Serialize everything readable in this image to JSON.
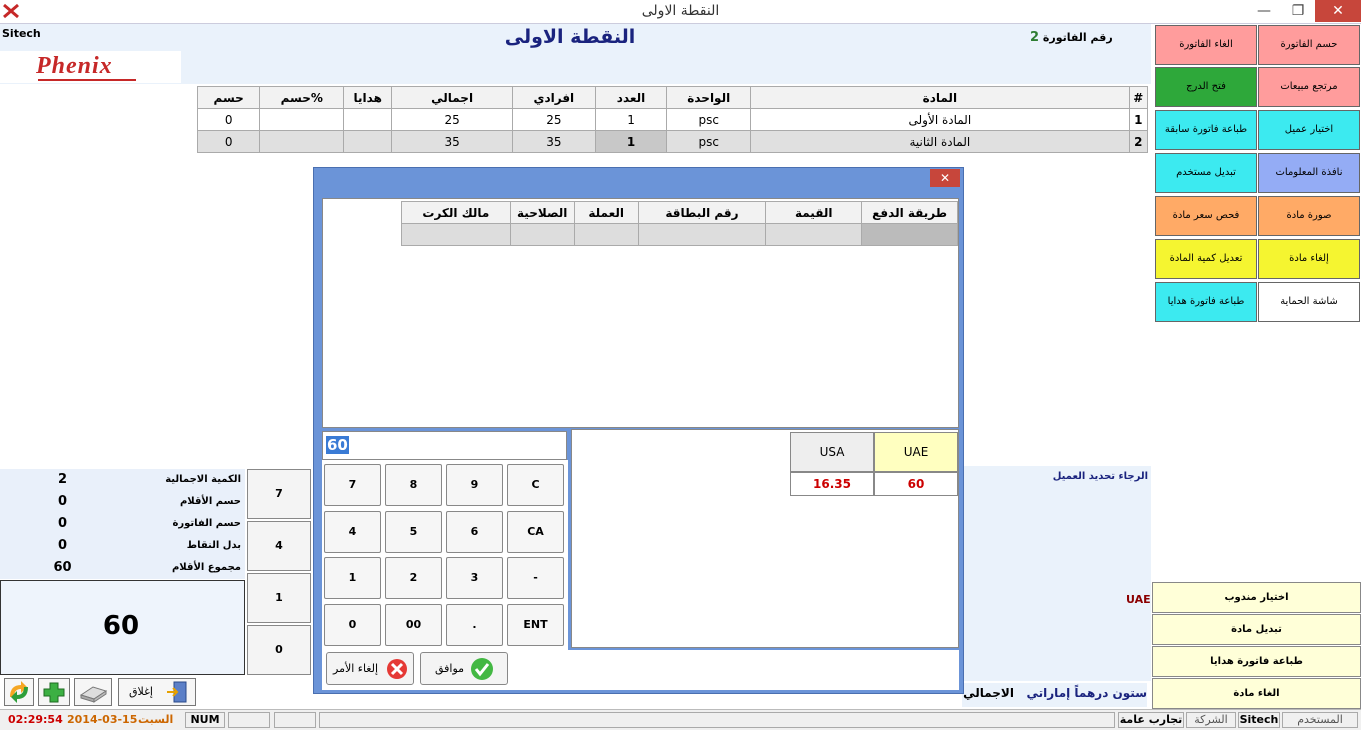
{
  "window": {
    "title": "النقطة الاولى",
    "icon": "x-logo-icon"
  },
  "header": {
    "company": "Sitech",
    "main_title": "النقطة الاولى",
    "invoice_label": "رقم الفاتورة",
    "invoice_number": "2",
    "logo_text": "Phenix"
  },
  "items_table": {
    "columns": [
      "#",
      "المادة",
      "الواحدة",
      "العدد",
      "افرادي",
      "اجمالي",
      "هدايا",
      "حسم%",
      "حسم"
    ],
    "rows": [
      {
        "num": "1",
        "item": "المادة الأولى",
        "unit": "psc",
        "qty": "1",
        "price": "25",
        "total": "25",
        "gifts": "",
        "disc_pct": "",
        "disc": "0"
      },
      {
        "num": "2",
        "item": "المادة الثانية",
        "unit": "psc",
        "qty": "1",
        "price": "35",
        "total": "35",
        "gifts": "",
        "disc_pct": "",
        "disc": "0"
      }
    ]
  },
  "right_buttons": [
    {
      "label": "حسم الفاتورة",
      "color": "#ff8c8c"
    },
    {
      "label": "الغاء الفاتورة",
      "color": "#ff8c8c"
    },
    {
      "label": "مرتجع مبيعات",
      "color": "#ff8c8c"
    },
    {
      "label": "فتح الدرج",
      "color": "#2e9e3a"
    },
    {
      "label": "اختيار عميل",
      "color": "#33e8f0"
    },
    {
      "label": "طباعة فاتورة سابقة",
      "color": "#33e8f0"
    },
    {
      "label": "نافذة المعلومات",
      "color": "#8fa8f5"
    },
    {
      "label": "تبديل مستخدم",
      "color": "#33e8f0"
    },
    {
      "label": "صورة مادة",
      "color": "#ffa860"
    },
    {
      "label": "فحص سعر مادة",
      "color": "#ffa860"
    },
    {
      "label": "إلغاء مادة",
      "color": "#f5f528"
    },
    {
      "label": "تعديل كمية المادة",
      "color": "#f5f528"
    },
    {
      "label": "شاشة الحماية",
      "color": "#ffffff"
    },
    {
      "label": "طباعة فاتورة هدايا",
      "color": "#33e8f0"
    }
  ],
  "bottom_right_buttons": [
    "اختيار مندوب",
    "تبديل مادة",
    "طباعة فاتورة هدايا",
    "الغاء مادة"
  ],
  "customer_prompt": "الرجاء تحديد العميل",
  "currency_side": "UAE",
  "total_words_label": "الاجمالي",
  "total_words": "ستون درهماً إماراتي",
  "summary": [
    {
      "label": "الكمية الاجمالية",
      "value": "2"
    },
    {
      "label": "حسم الأقلام",
      "value": "0"
    },
    {
      "label": "حسم الفاتورة",
      "value": "0"
    },
    {
      "label": "بدل النقاط",
      "value": "0"
    },
    {
      "label": "مجموع الأقلام",
      "value": "60"
    }
  ],
  "big_total": "60",
  "side_keys": [
    "7",
    "4",
    "1",
    "0"
  ],
  "bottom_toolbar": {
    "close_label": "إغلاق"
  },
  "payment_dialog": {
    "columns": [
      "طريقة الدفع",
      "القيمة",
      "رقم البطاقة",
      "العملة",
      "الصلاحية",
      "مالك الكرت"
    ],
    "input_value": "60",
    "keys": [
      [
        "7",
        "8",
        "9",
        "C"
      ],
      [
        "4",
        "5",
        "6",
        "CA"
      ],
      [
        "1",
        "2",
        "3",
        "-"
      ],
      [
        "0",
        "00",
        ".",
        "ENT"
      ]
    ],
    "currencies": [
      {
        "name": "UAE",
        "amount": "60"
      },
      {
        "name": "USA",
        "amount": "16.35"
      }
    ],
    "ok_label": "موافق",
    "cancel_label": "إلغاء الأمر"
  },
  "status_bar": {
    "time": "02:29:54",
    "date": "2014-03-15",
    "day": "السبت",
    "num": "NUM",
    "company_label": "الشركة",
    "company_value": "تجارب عامة",
    "user_label": "المستخدم",
    "user_value": "Sitech"
  }
}
